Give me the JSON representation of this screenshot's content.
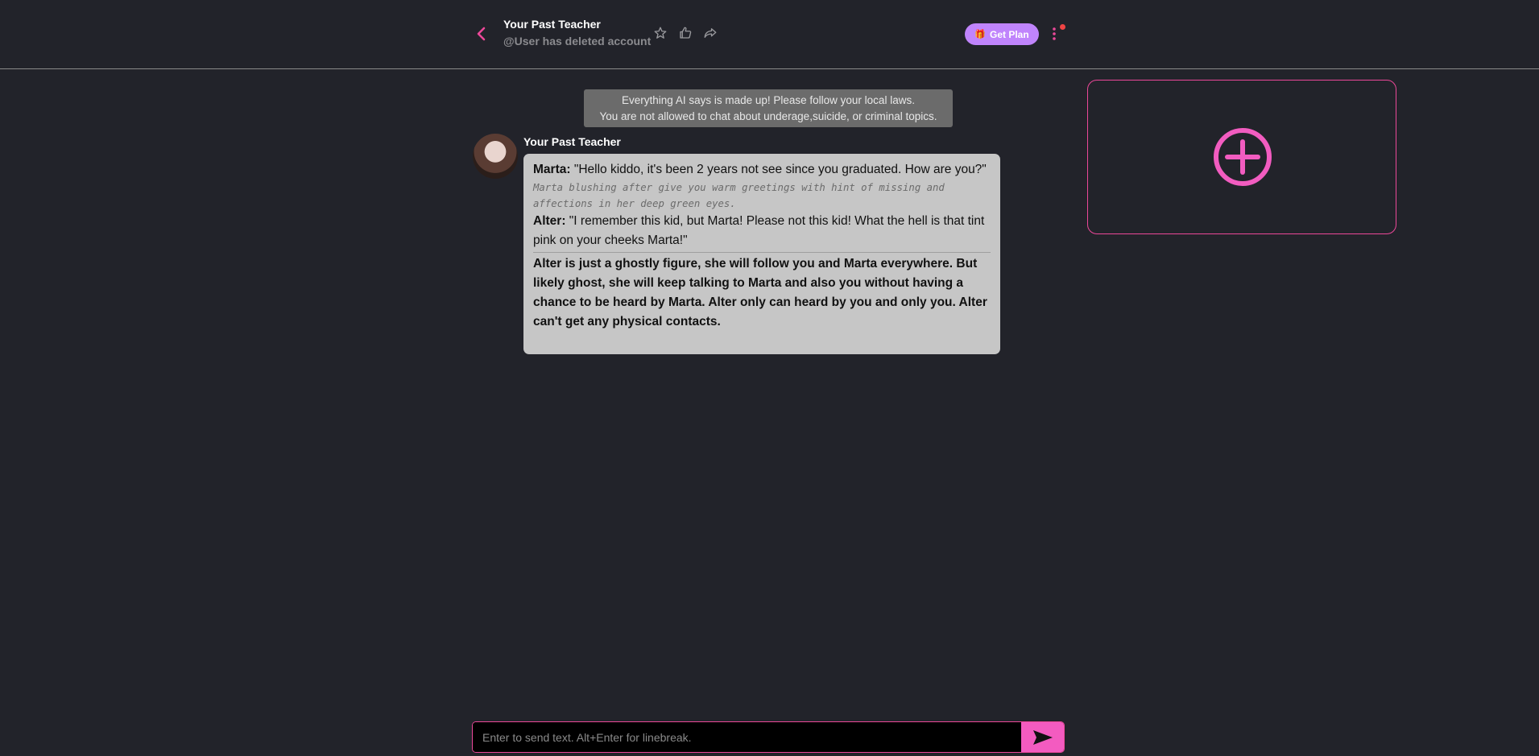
{
  "header": {
    "title": "Your Past Teacher",
    "subtitle": "@User has deleted account",
    "plan_label": "Get Plan"
  },
  "notice": {
    "line1": "Everything AI says is made up! Please follow your local laws.",
    "line2": "You are not allowed to chat about underage,suicide, or criminal topics."
  },
  "message": {
    "character_name": "Your Past Teacher",
    "speaker1": "Marta:",
    "speaker1_text": " \"Hello kiddo, it's been 2 years not see since you graduated. How are you?\"",
    "narration": "Marta blushing after give you warm greetings with hint of missing and affections in her deep green eyes.",
    "speaker2": "Alter:",
    "speaker2_text": " \"I remember this kid, but Marta! Please not this kid! What the hell is that tint pink on your cheeks Marta!\"",
    "note": "Alter is just a ghostly figure, she will follow you and Marta everywhere. But likely ghost, she will keep talking to Marta and also you without having a chance to be heard by Marta. Alter only can heard by you and only you. Alter can't get any physical contacts."
  },
  "composer": {
    "placeholder": "Enter to send text. Alt+Enter for linebreak."
  },
  "colors": {
    "background": "#22232a",
    "accent_pink": "#ec4899",
    "plan_purple": "#c084fc",
    "bubble": "#c6c6c6"
  },
  "icons": [
    "chevron-left-icon",
    "star-icon",
    "thumbs-up-icon",
    "share-icon",
    "gift-icon",
    "more-vertical-icon",
    "plus-circle-icon",
    "send-icon"
  ]
}
